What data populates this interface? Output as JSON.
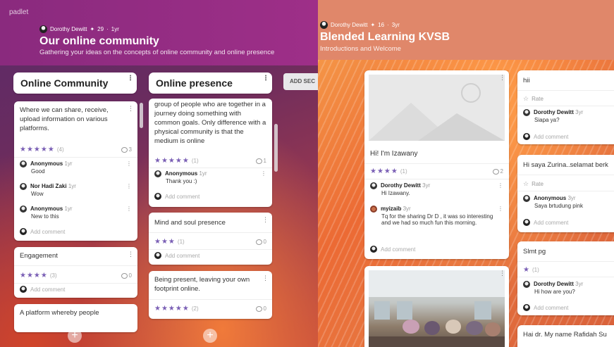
{
  "left": {
    "logo": "padlet",
    "author": "Dorothy Dewitt",
    "meta_sep": "✦",
    "likes": "29",
    "dot": "·",
    "age": "1yr",
    "title": "Our online community",
    "subtitle": "Gathering your ideas on the concepts of online community and online presence",
    "add_section": "ADD SEC",
    "columns": [
      {
        "title": "Online Community",
        "cards": [
          {
            "body": "Where we can share, receive, upload information on various platforms.",
            "stars": "★★★★★",
            "rating_count": "(4)",
            "comment_count": "3",
            "comments": [
              {
                "name": "Anonymous",
                "age": "1yr",
                "text": "Good"
              },
              {
                "name": "Nor Hadi Zaki",
                "age": "1yr",
                "text": "Wow"
              },
              {
                "name": "Anonymous",
                "age": "1yr",
                "text": "New to this"
              }
            ],
            "add_comment": "Add comment"
          },
          {
            "body": "Engagement",
            "stars": "★★★★",
            "rating_count": "(3)",
            "comment_count": "0",
            "add_comment": "Add comment"
          },
          {
            "body": "A platform whereby people"
          }
        ]
      },
      {
        "title": "Online presence",
        "cards": [
          {
            "body": "group of people who are together in a journey doing something with common goals. Only difference with a physical community is that the medium is online",
            "stars": "★★★★★",
            "rating_count": "(1)",
            "comment_count": "1",
            "comments": [
              {
                "name": "Anonymous",
                "age": "1yr",
                "text": "Thank you :)"
              }
            ],
            "add_comment": "Add comment"
          },
          {
            "body": "Mind and soul presence",
            "stars": "★★★",
            "rating_count": "(1)",
            "comment_count": "0",
            "add_comment": "Add comment"
          },
          {
            "body": "Being present, leaving your own footprint online.",
            "stars": "★★★★★",
            "rating_count": "(2)",
            "comment_count": "0"
          }
        ]
      }
    ],
    "plus": "+"
  },
  "right": {
    "author": "Dorothy Dewitt",
    "meta_sep": "✦",
    "likes": "16",
    "dot": "·",
    "age": "3yr",
    "title": "Blended Learning KVSB",
    "subtitle": "Introductions and Welcome",
    "col1": [
      {
        "body": "Hi! I'm Izawany",
        "stars": "★★★★",
        "rating_count": "(1)",
        "comment_count": "2",
        "comments": [
          {
            "name": "Dorothy Dewitt",
            "age": "3yr",
            "text": "Hi Izawany."
          },
          {
            "name": "myizaib",
            "age": "3yr",
            "text": "Tq for the sharing Dr D , it was so interesting and we had so much fun this morning."
          }
        ],
        "add_comment": "Add comment"
      }
    ],
    "col2": [
      {
        "body": "hii",
        "rate": "Rate",
        "comments": [
          {
            "name": "Dorothy Dewitt",
            "age": "3yr",
            "text": "Siapa ya?"
          }
        ],
        "add_comment": "Add comment"
      },
      {
        "body": "Hi saya Zurina..selamat berk",
        "rate": "Rate",
        "comments": [
          {
            "name": "Anonymous",
            "age": "3yr",
            "text": "Saya brtudung pink"
          }
        ],
        "add_comment": "Add comment"
      },
      {
        "body": "Slmt pg",
        "stars": "★",
        "rating_count": "(1)",
        "comments": [
          {
            "name": "Dorothy Dewitt",
            "age": "3yr",
            "text": "Hi how are you?"
          }
        ],
        "add_comment": "Add comment"
      },
      {
        "body": "Hai dr. My name Rafidah Su"
      }
    ]
  },
  "colors": {
    "star": "#7a5fb5",
    "left_header": "#9e2f88",
    "right_header": "#e0876a"
  }
}
